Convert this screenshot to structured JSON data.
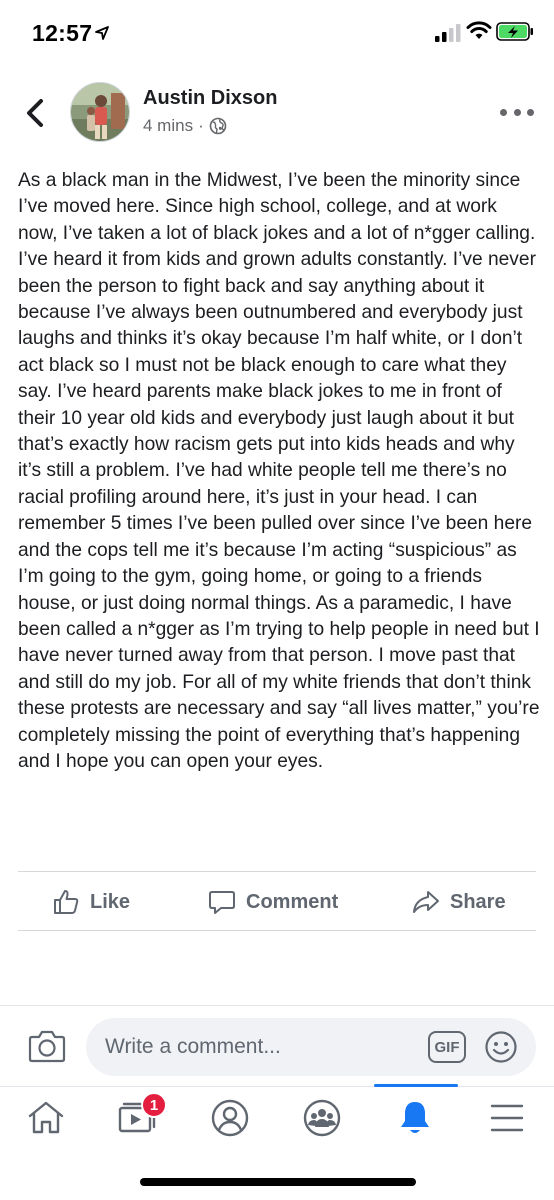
{
  "status_bar": {
    "time": "12:57"
  },
  "post": {
    "author": "Austin Dixson",
    "time_ago": "4 mins",
    "separator": "·",
    "privacy_icon": "globe-icon",
    "body": "As a black man in the Midwest, I’ve been the minority since I’ve moved here. Since high school, college, and at work now, I’ve taken a lot of black jokes and a lot of n*gger calling. I’ve heard it from kids and grown adults constantly. I’ve never been the person to fight back and say anything about it because I’ve always been outnumbered and everybody just laughs and thinks it’s okay because I’m half white, or I don’t act black so I must not be black enough to care what they say. I’ve heard parents make black jokes to me in front of their 10 year old kids and everybody just laugh about it but that’s exactly how racism gets put into kids heads and why it’s still a problem. I’ve had white people tell me there’s no racial profiling around here, it’s just in your head. I can remember 5 times I’ve been pulled over since I’ve been here and the cops tell me it’s because I’m acting “suspicious” as I’m going to the gym, going home, or going to a friends house, or just doing normal things. As a paramedic, I have been called a n*gger as I’m trying to help people in need but I have never turned away from that person. I move past that and still do my job. For all of my white friends that don’t think these protests are necessary and say “all lives matter,” you’re completely missing the point of everything that’s happening and I hope you can open your eyes."
  },
  "actions": {
    "like": "Like",
    "comment": "Comment",
    "share": "Share"
  },
  "composer": {
    "placeholder": "Write a comment...",
    "gif_label": "GIF"
  },
  "nav": {
    "items": [
      "home-icon",
      "watch-icon",
      "profile-icon",
      "groups-icon",
      "notifications-icon",
      "menu-icon"
    ],
    "active": "notifications-icon",
    "watch_badge": "1"
  },
  "colors": {
    "accent": "#1877f2",
    "badge": "#e41e3f",
    "text_secondary": "#65676b",
    "input_bg": "#f0f2f5"
  }
}
